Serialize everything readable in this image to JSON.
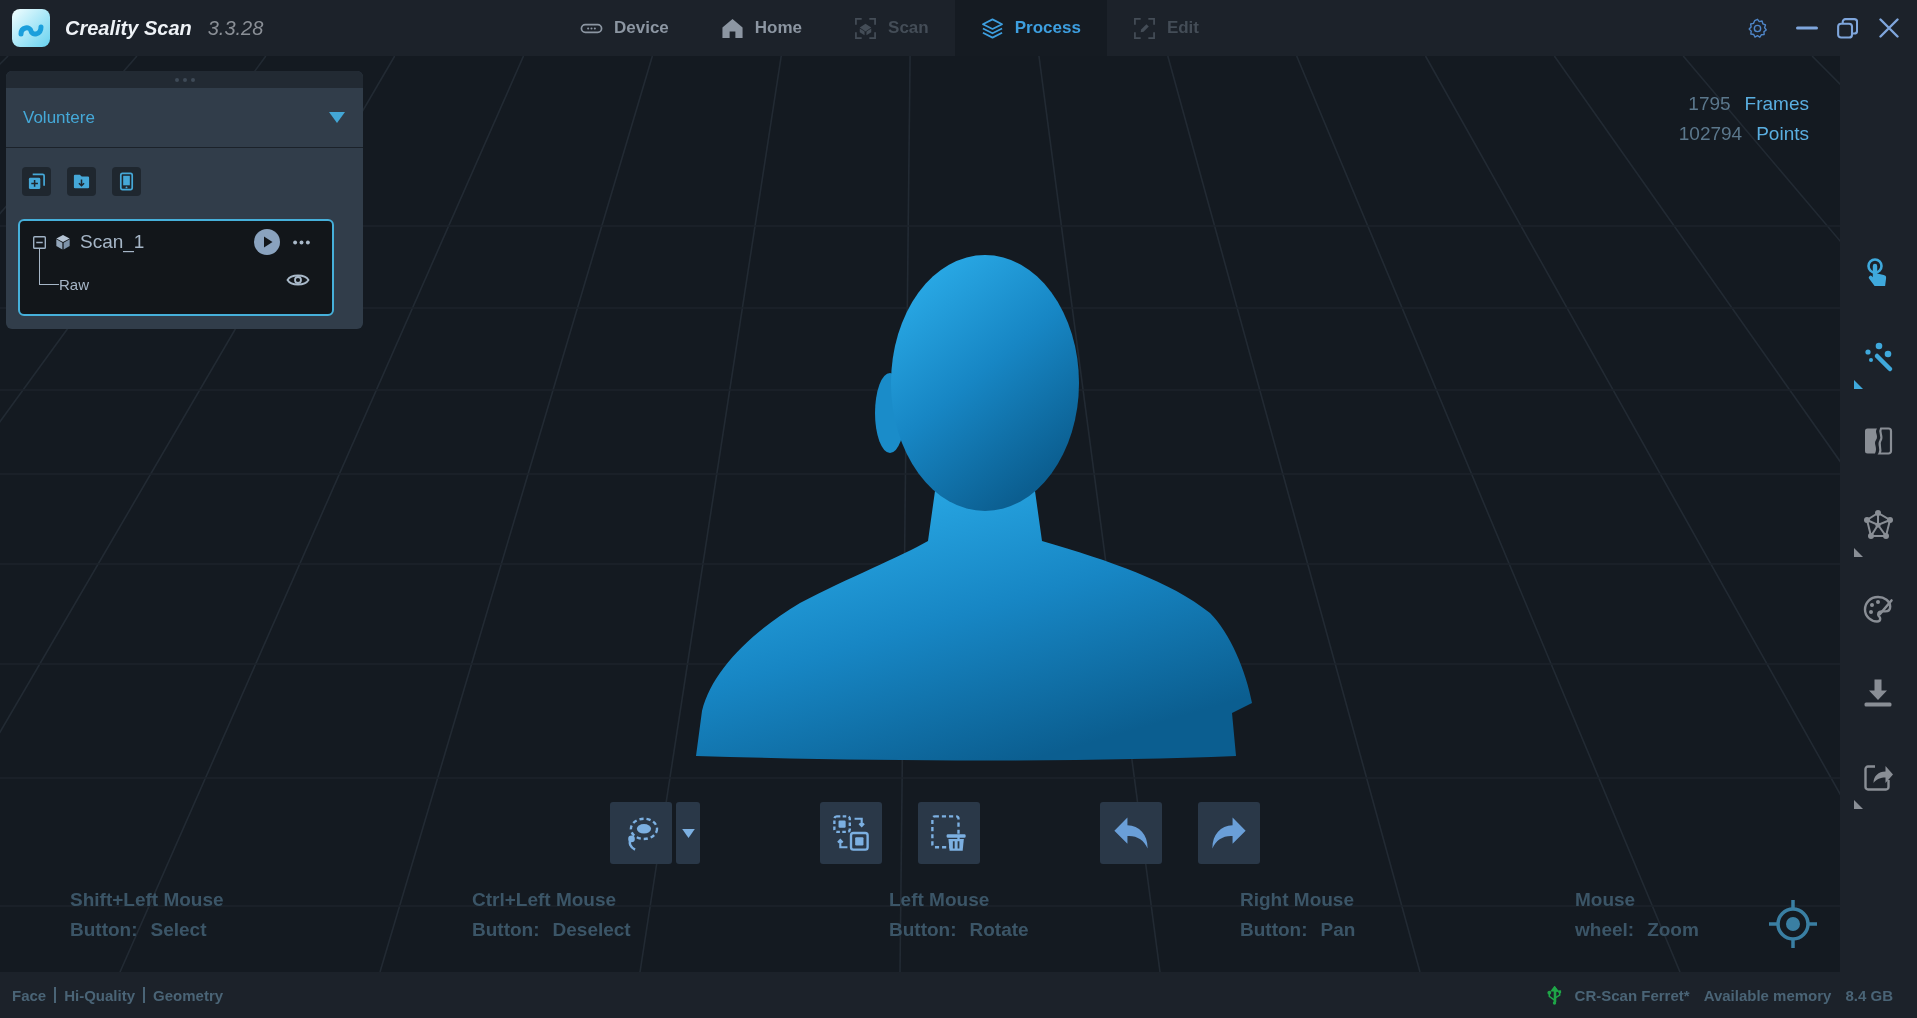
{
  "window": {
    "title": "Creality Scan",
    "version": "3.3.28"
  },
  "tabs": [
    {
      "label": "Device",
      "kind": "device",
      "selected": false,
      "disabled": false
    },
    {
      "label": "Home",
      "kind": "home",
      "selected": false,
      "disabled": false
    },
    {
      "label": "Scan",
      "kind": "scan",
      "selected": false,
      "disabled": true
    },
    {
      "label": "Process",
      "kind": "process",
      "selected": true,
      "disabled": false
    },
    {
      "label": "Edit",
      "kind": "edit",
      "selected": false,
      "disabled": true
    }
  ],
  "project_panel": {
    "project": "Voluntere",
    "actions": [
      {
        "kind": "add"
      },
      {
        "kind": "import"
      },
      {
        "kind": "tablet"
      }
    ],
    "scans": [
      {
        "name": "Scan_1",
        "selected": true,
        "expanded": true,
        "children": [
          {
            "name": "Raw",
            "visible": true
          }
        ]
      }
    ]
  },
  "stats": [
    {
      "count": "1795",
      "unit": "Frames"
    },
    {
      "count": "102794",
      "unit": "Points"
    }
  ],
  "edit_tools": [
    {
      "tools": [
        {
          "kind": "lasso",
          "dropdown": true
        }
      ]
    },
    {
      "tools": [
        {
          "kind": "invert"
        },
        {
          "kind": "delete"
        }
      ]
    },
    {
      "tools": [
        {
          "kind": "undo"
        },
        {
          "kind": "redo"
        }
      ]
    }
  ],
  "mouse_hints": [
    {
      "title": "Shift+Left Mouse",
      "prefix": "Button:",
      "action": "Select"
    },
    {
      "title": "Ctrl+Left Mouse",
      "prefix": "Button:",
      "action": "Deselect"
    },
    {
      "title": "Left Mouse",
      "prefix": "Button:",
      "action": "Rotate"
    },
    {
      "title": "Right Mouse",
      "prefix": "Button:",
      "action": "Pan"
    },
    {
      "title": "Mouse",
      "prefix": "wheel:",
      "action": "Zoom"
    }
  ],
  "side_tools": [
    {
      "kind": "touch",
      "active": true
    },
    {
      "kind": "wand",
      "active": true,
      "submenu": true
    },
    {
      "kind": "split",
      "active": false
    },
    {
      "kind": "mesh",
      "active": false,
      "submenu": true
    },
    {
      "kind": "palette",
      "active": false
    },
    {
      "kind": "download",
      "active": false
    },
    {
      "kind": "share",
      "active": false,
      "submenu": true
    }
  ],
  "status_bar": {
    "modes": [
      "Face",
      "Hi-Quality",
      "Geometry"
    ],
    "device": "CR-Scan Ferret*",
    "connected": true,
    "memory_label": "Available memory",
    "memory": "8.4 GB"
  }
}
